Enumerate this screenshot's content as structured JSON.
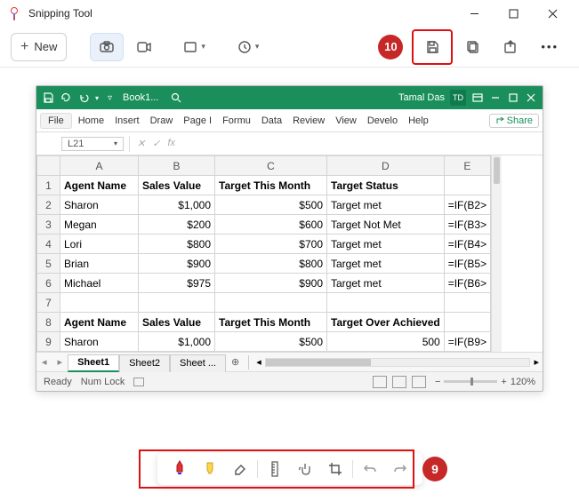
{
  "app": {
    "title": "Snipping Tool",
    "new_label": "New"
  },
  "badges": {
    "ten": "10",
    "nine": "9"
  },
  "excel": {
    "doc_name": "Book1...",
    "user_name": "Tamal Das",
    "user_initials": "TD",
    "tabs": [
      "File",
      "Home",
      "Insert",
      "Draw",
      "Page I",
      "Formu",
      "Data",
      "Review",
      "View",
      "Develo",
      "Help"
    ],
    "share_label": "Share",
    "namebox": "L21",
    "fx_label": "fx",
    "columns": [
      "",
      "A",
      "B",
      "C",
      "D",
      "E"
    ],
    "rows": [
      {
        "n": "1",
        "bold": true,
        "cells": [
          "Agent Name",
          "Sales Value",
          "Target This Month",
          "Target Status",
          ""
        ]
      },
      {
        "n": "2",
        "cells": [
          "Sharon",
          "$1,000",
          "$500",
          "Target met",
          "=IF(B2>"
        ]
      },
      {
        "n": "3",
        "cells": [
          "Megan",
          "$200",
          "$600",
          "Target Not Met",
          "=IF(B3>"
        ]
      },
      {
        "n": "4",
        "cells": [
          "Lori",
          "$800",
          "$700",
          "Target met",
          "=IF(B4>"
        ]
      },
      {
        "n": "5",
        "cells": [
          "Brian",
          "$900",
          "$800",
          "Target met",
          "=IF(B5>"
        ]
      },
      {
        "n": "6",
        "cells": [
          "Michael",
          "$975",
          "$900",
          "Target met",
          "=IF(B6>"
        ]
      },
      {
        "n": "7",
        "cells": [
          "",
          "",
          "",
          "",
          ""
        ]
      },
      {
        "n": "8",
        "bold": true,
        "cells": [
          "Agent Name",
          "Sales Value",
          "Target This Month",
          "Target Over Achieved",
          ""
        ]
      },
      {
        "n": "9",
        "cells": [
          "Sharon",
          "$1,000",
          "$500",
          "500",
          "=IF(B9>"
        ]
      }
    ],
    "sheets": [
      "Sheet1",
      "Sheet2",
      "Sheet ..."
    ],
    "status_ready": "Ready",
    "status_numlock": "Num Lock",
    "zoom_label": "120%"
  }
}
